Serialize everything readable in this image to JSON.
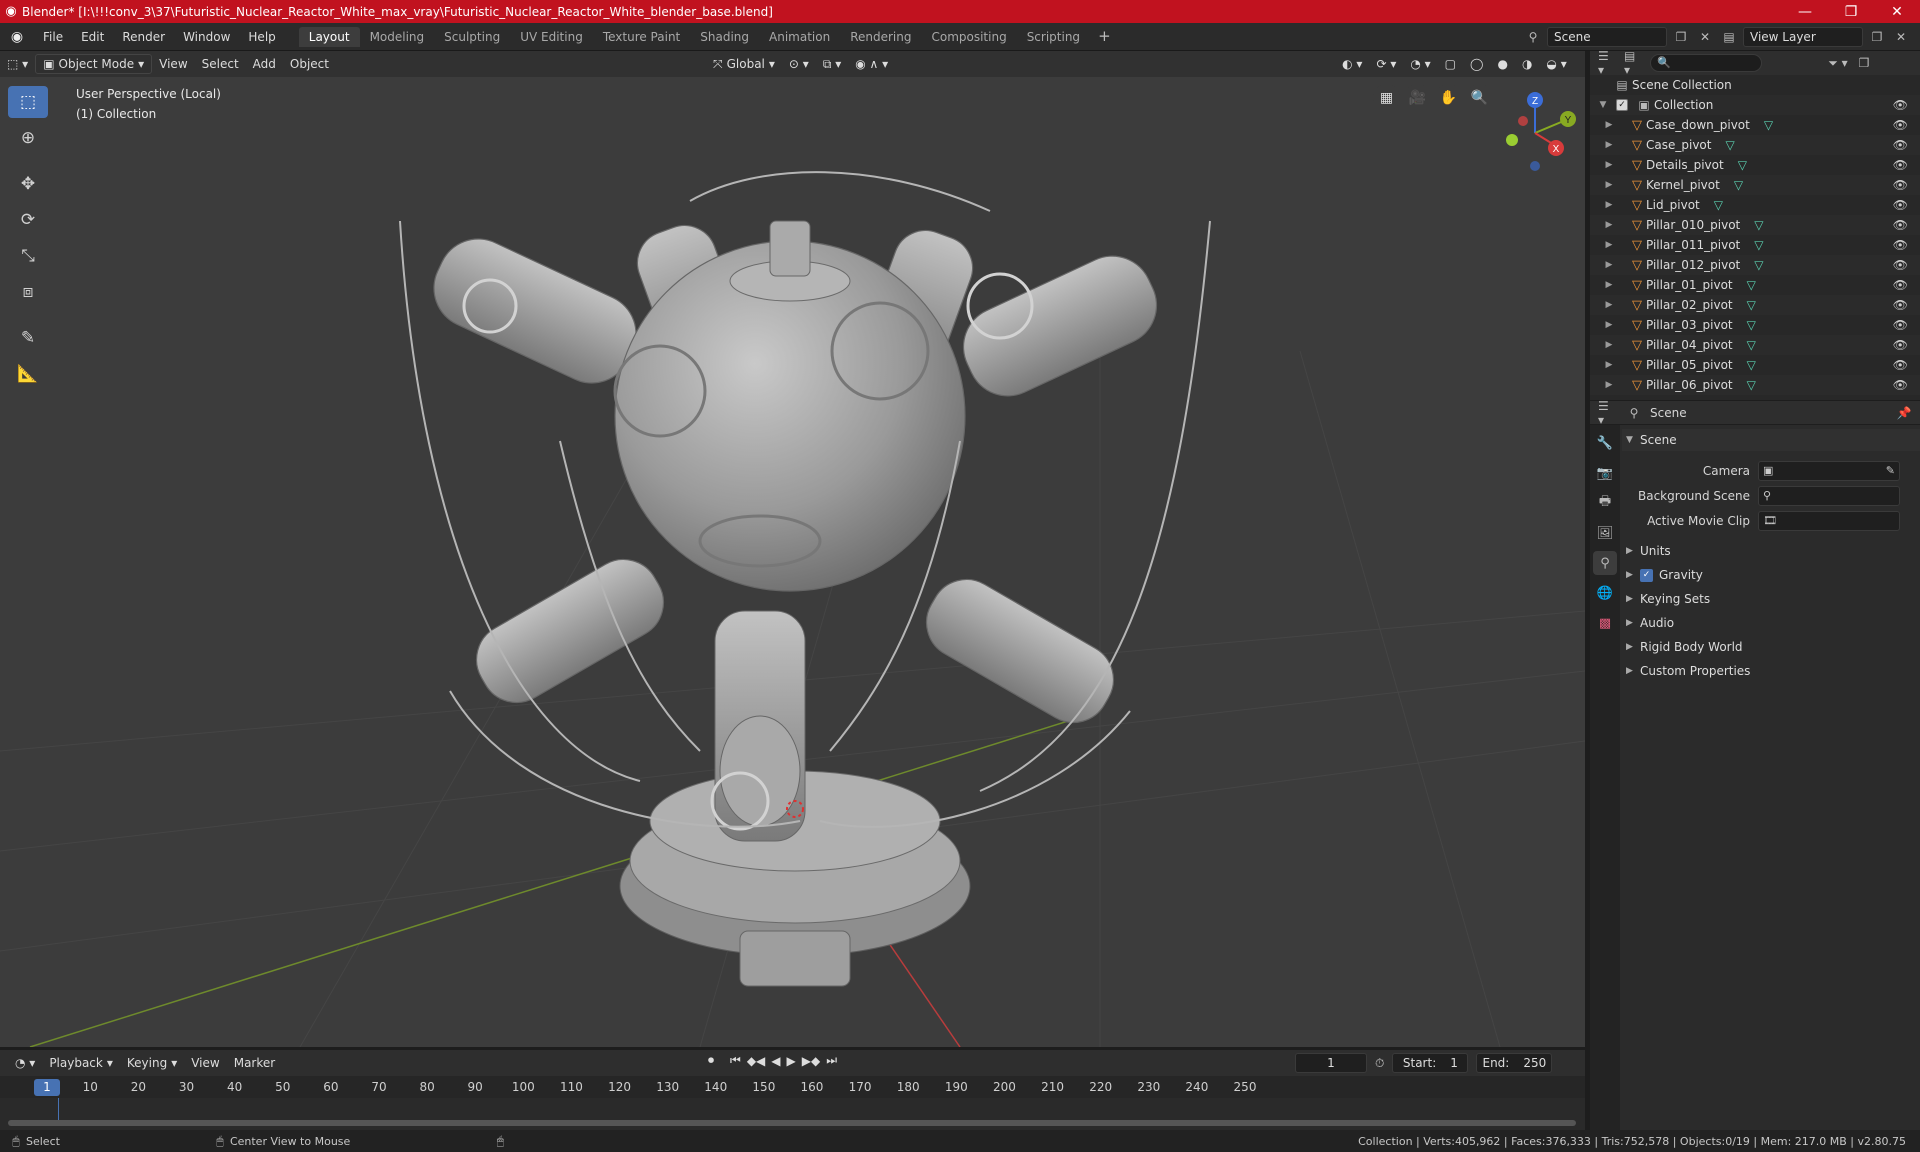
{
  "titlebar": {
    "title": "Blender* [I:\\!!!conv_3\\37\\Futuristic_Nuclear_Reactor_White_max_vray\\Futuristic_Nuclear_Reactor_White_blender_base.blend]",
    "minimize": "—",
    "maximize": "❐",
    "close": "✕"
  },
  "menu": {
    "file": "File",
    "edit": "Edit",
    "render": "Render",
    "window": "Window",
    "help": "Help"
  },
  "workspaces": [
    "Layout",
    "Modeling",
    "Sculpting",
    "UV Editing",
    "Texture Paint",
    "Shading",
    "Animation",
    "Rendering",
    "Compositing",
    "Scripting"
  ],
  "scene": {
    "name": "Scene",
    "view_layer": "View Layer"
  },
  "viewport": {
    "mode": "Object Mode",
    "view": "View",
    "select": "Select",
    "add": "Add",
    "object": "Object",
    "orientation": "Global",
    "info_line1": "User Perspective (Local)",
    "info_line2": "(1) Collection",
    "axis_x": "X",
    "axis_y": "Y",
    "axis_z": "Z"
  },
  "outliner": {
    "root": "Scene Collection",
    "collection": "Collection",
    "items": [
      "Case_down_pivot",
      "Case_pivot",
      "Details_pivot",
      "Kernel_pivot",
      "Lid_pivot",
      "Pillar_010_pivot",
      "Pillar_011_pivot",
      "Pillar_012_pivot",
      "Pillar_01_pivot",
      "Pillar_02_pivot",
      "Pillar_03_pivot",
      "Pillar_04_pivot",
      "Pillar_05_pivot",
      "Pillar_06_pivot"
    ]
  },
  "properties": {
    "context": "Scene",
    "panel": "Scene",
    "camera_label": "Camera",
    "background_label": "Background Scene",
    "movie_clip_label": "Active Movie Clip",
    "sections": [
      "Units",
      "Gravity",
      "Keying Sets",
      "Audio",
      "Rigid Body World",
      "Custom Properties"
    ]
  },
  "timeline": {
    "playback": "Playback",
    "keying": "Keying",
    "view": "View",
    "marker": "Marker",
    "current_frame": "1",
    "start_label": "Start:",
    "start": "1",
    "end_label": "End:",
    "end": "250",
    "ticks": [
      "10",
      "20",
      "30",
      "40",
      "50",
      "60",
      "70",
      "80",
      "90",
      "100",
      "110",
      "120",
      "130",
      "140",
      "150",
      "160",
      "170",
      "180",
      "190",
      "200",
      "210",
      "220",
      "230",
      "240",
      "250"
    ],
    "ruler_current": "1"
  },
  "statusbar": {
    "select": "Select",
    "center": "Center View to Mouse",
    "stats": "Collection | Verts:405,962 | Faces:376,333 | Tris:752,578 | Objects:0/19 | Mem: 217.0 MB | v2.80.75"
  },
  "colors": {
    "titlebar": "#c1121f",
    "accent": "#4772b3",
    "object_icon": "#e8923a",
    "mesh_icon": "#5ad0b0"
  }
}
